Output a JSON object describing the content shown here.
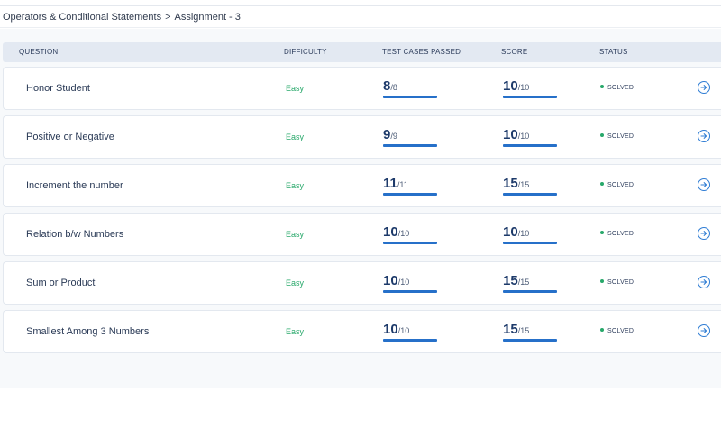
{
  "breadcrumb": {
    "parent": "Operators & Conditional Statements",
    "separator": ">",
    "current": "Assignment - 3"
  },
  "table": {
    "headers": {
      "question": "QUESTION",
      "difficulty": "DIFFICULTY",
      "test_cases": "TEST CASES PASSED",
      "score": "SCORE",
      "status": "STATUS"
    },
    "rows": [
      {
        "question": "Honor Student",
        "difficulty": "Easy",
        "passed": "8",
        "total": "/8",
        "score": "10",
        "max": "/10",
        "status": "SOLVED"
      },
      {
        "question": "Positive or Negative",
        "difficulty": "Easy",
        "passed": "9",
        "total": "/9",
        "score": "10",
        "max": "/10",
        "status": "SOLVED"
      },
      {
        "question": "Increment the number",
        "difficulty": "Easy",
        "passed": "11",
        "total": "/11",
        "score": "15",
        "max": "/15",
        "status": "SOLVED"
      },
      {
        "question": "Relation b/w Numbers",
        "difficulty": "Easy",
        "passed": "10",
        "total": "/10",
        "score": "10",
        "max": "/10",
        "status": "SOLVED"
      },
      {
        "question": "Sum or Product",
        "difficulty": "Easy",
        "passed": "10",
        "total": "/10",
        "score": "15",
        "max": "/15",
        "status": "SOLVED"
      },
      {
        "question": "Smallest Among 3 Numbers",
        "difficulty": "Easy",
        "passed": "10",
        "total": "/10",
        "score": "15",
        "max": "/15",
        "status": "SOLVED"
      }
    ]
  },
  "icons": {
    "row_action": "arrow-right-circle-icon",
    "status": "status-dot-icon"
  },
  "colors": {
    "accent": "#2670c9",
    "easy": "#27a86a",
    "solved_dot": "#27a86a",
    "header_bg": "#e3e9f2"
  }
}
